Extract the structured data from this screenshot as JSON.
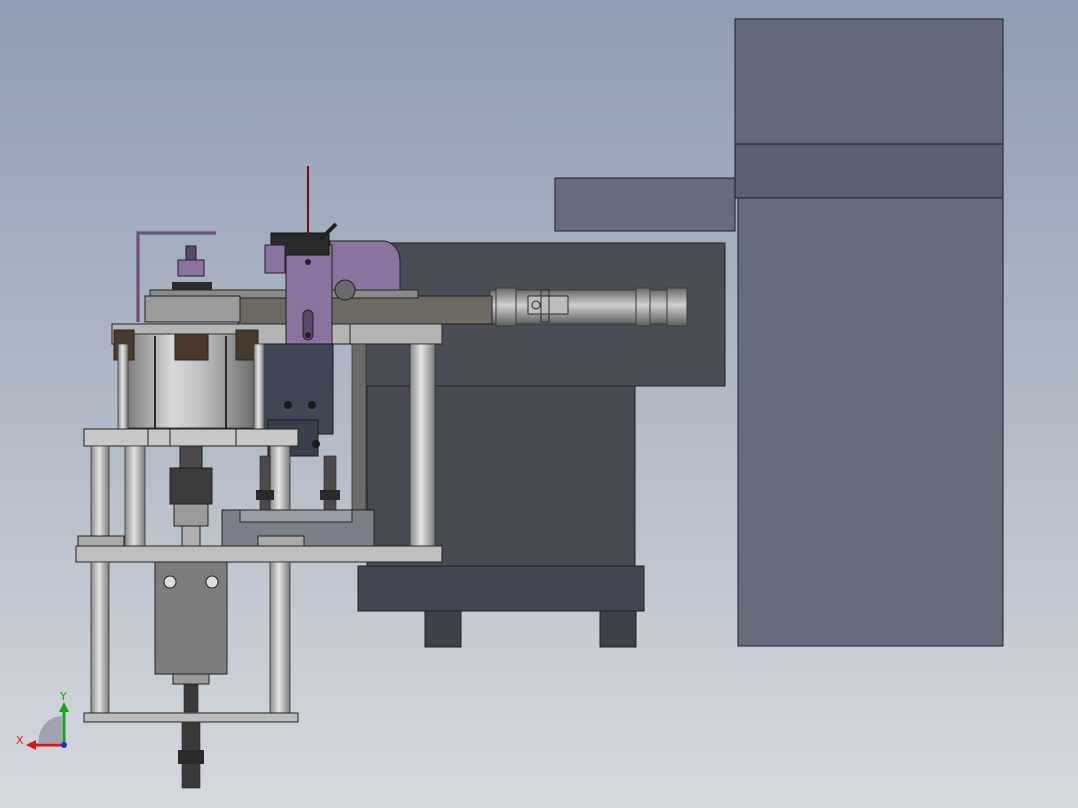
{
  "triad": {
    "x_label": "X",
    "y_label": "Y",
    "x_color": "#d11a1a",
    "y_color": "#1aa31a",
    "z_color": "#1a2fd1"
  },
  "colors": {
    "background_top": "#8e9db3",
    "background_bottom": "#d6d9de",
    "housing": "#646a7a",
    "housing_mid": "#5a6070",
    "dark_block": "#4a4d55",
    "steel": "#a6a6a6",
    "purple_part": "#8a739e",
    "dark_blue_part": "#3f4656",
    "brown_part": "#4a3a2e"
  }
}
